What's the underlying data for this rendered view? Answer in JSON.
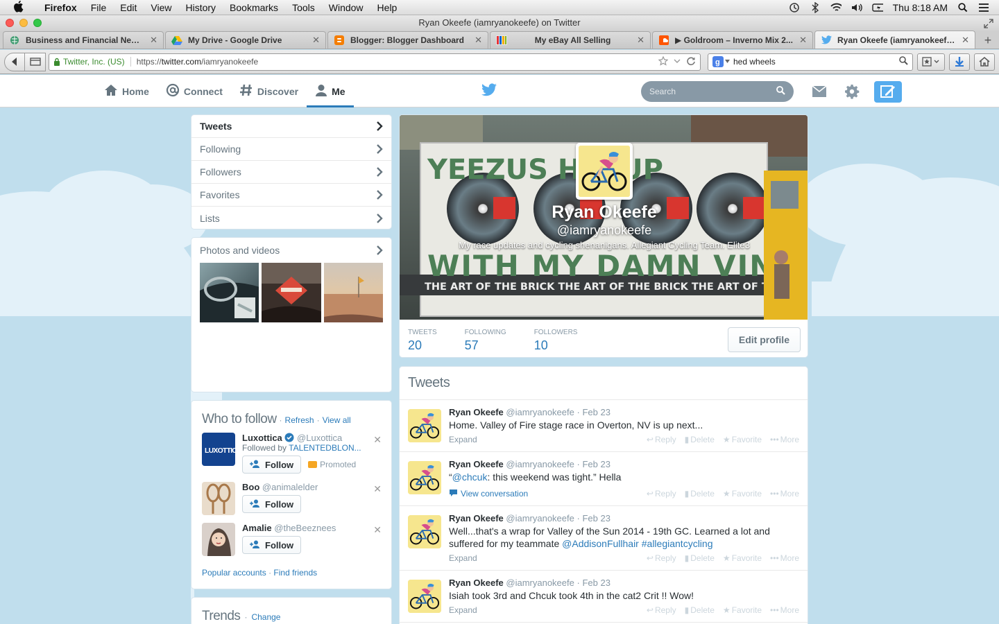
{
  "menubar": {
    "app": "Firefox",
    "items": [
      "File",
      "Edit",
      "View",
      "History",
      "Bookmarks",
      "Tools",
      "Window",
      "Help"
    ],
    "clock": "Thu 8:18 AM"
  },
  "window": {
    "title": "Ryan Okeefe (iamryanokeefe) on Twitter"
  },
  "tabs": [
    {
      "label": "Business and Financial News...",
      "favicon": "globe-icon"
    },
    {
      "label": "My Drive - Google Drive",
      "favicon": "google-drive-icon"
    },
    {
      "label": "Blogger: Blogger Dashboard",
      "favicon": "blogger-icon"
    },
    {
      "label": "My eBay All Selling",
      "favicon": "ebay-icon"
    },
    {
      "label": "▶ Goldroom – Inverno Mix 2...",
      "favicon": "soundcloud-icon"
    },
    {
      "label": "Ryan Okeefe (iamryanokeefe...",
      "favicon": "twitter-icon"
    }
  ],
  "urlbar": {
    "identity": "Twitter, Inc. (US)",
    "scheme": "https://",
    "host": "twitter.com",
    "path": "/iamryanokeefe"
  },
  "searchbar": {
    "value": "hed wheels"
  },
  "twitter": {
    "nav": [
      {
        "label": "Home",
        "icon": "home-icon"
      },
      {
        "label": "Connect",
        "icon": "at-icon"
      },
      {
        "label": "Discover",
        "icon": "hash-icon"
      },
      {
        "label": "Me",
        "icon": "person-icon"
      }
    ],
    "search_placeholder": "Search"
  },
  "profile_nav": [
    "Tweets",
    "Following",
    "Followers",
    "Favorites",
    "Lists"
  ],
  "photos": {
    "title": "Photos and videos"
  },
  "who_to_follow": {
    "title": "Who to follow",
    "refresh": "Refresh",
    "view_all": "View all",
    "users": [
      {
        "name": "Luxottica",
        "handle": "@Luxottica",
        "followed_by_prefix": "Followed by",
        "followed_by": "TALENTEDBLON...",
        "follow": "Follow",
        "promoted": "Promoted",
        "verified": true
      },
      {
        "name": "Boo",
        "handle": "@animalelder",
        "follow": "Follow"
      },
      {
        "name": "Amalie",
        "handle": "@theBeeznees",
        "follow": "Follow"
      }
    ],
    "popular": "Popular accounts",
    "find_friends": "Find friends"
  },
  "trends": {
    "title": "Trends",
    "change": "Change"
  },
  "profile": {
    "name": "Ryan Okeefe",
    "handle": "@iamryanokeefe",
    "bio": "My race updates and cycling shenanigans. Allegiant Cycling Team. Elite3",
    "banner_text_top": "YEEZUS H   Y UP",
    "banner_text_mid": "WITH MY DAMN VINYL",
    "banner_text_bot": "THE ART OF THE BRICK  THE ART OF THE BRICK  THE ART OF THE BRICK  THE ART OF THE BRICK",
    "stats": [
      {
        "label": "Tweets",
        "value": "20"
      },
      {
        "label": "Following",
        "value": "57"
      },
      {
        "label": "Followers",
        "value": "10"
      }
    ],
    "edit": "Edit profile"
  },
  "tweets": {
    "title": "Tweets",
    "actions": {
      "reply": "Reply",
      "delete": "Delete",
      "favorite": "Favorite",
      "more": "More"
    },
    "items": [
      {
        "name": "Ryan Okeefe",
        "handle": "@iamryanokeefe",
        "date": "Feb 23",
        "text": "Home. Valley of Fire stage race in Overton, NV is up next...",
        "footer": "Expand"
      },
      {
        "name": "Ryan Okeefe",
        "handle": "@iamryanokeefe",
        "date": "Feb 23",
        "text_pre": "“",
        "mention": "@chcuk",
        "text_post": ": this weekend was tight.” Hella",
        "footer": "View conversation"
      },
      {
        "name": "Ryan Okeefe",
        "handle": "@iamryanokeefe",
        "date": "Feb 23",
        "text": "Well...that's a wrap for Valley of the Sun 2014 - 19th GC. Learned a lot and suffered for my teammate ",
        "mention": "@AddisonFullhair",
        "hashtag": "#allegiantcycling",
        "footer": "Expand"
      },
      {
        "name": "Ryan Okeefe",
        "handle": "@iamryanokeefe",
        "date": "Feb 23",
        "text": "Isiah took 3rd and Chcuk took 4th in the cat2 Crit !! Wow!",
        "footer": "Expand"
      }
    ]
  }
}
